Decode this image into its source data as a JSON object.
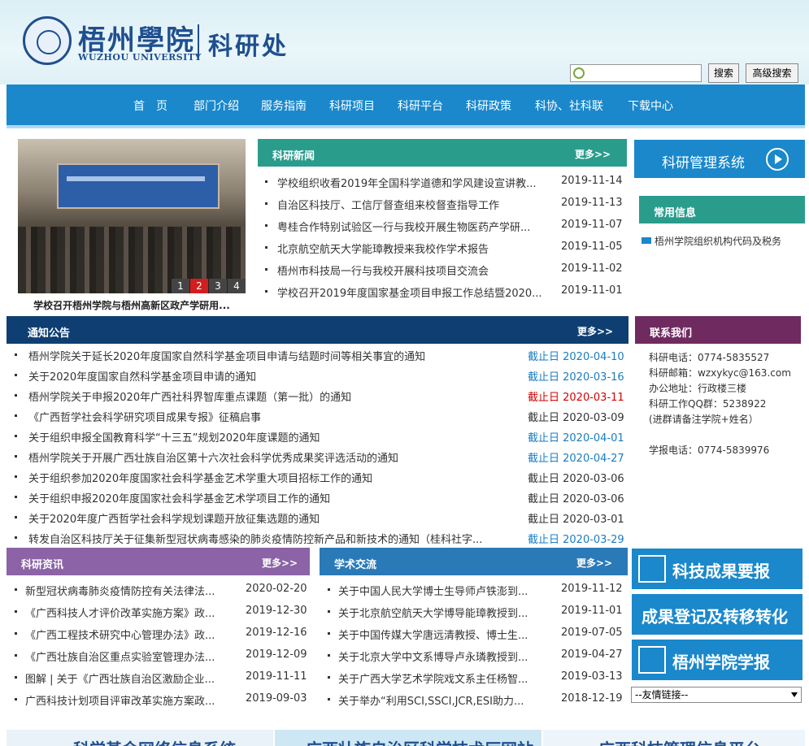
{
  "header": {
    "logo_cn": "梧州學院",
    "logo_en": "WUZHOU UNIVERSITY",
    "dept": "科研处",
    "search_placeholder": "",
    "search_label": "搜索",
    "advanced_search_label": "高级搜索"
  },
  "nav": [
    "首　页",
    "部门介绍",
    "服务指南",
    "科研项目",
    "科研平台",
    "科研政策",
    "科协、社科联",
    "下载中心"
  ],
  "slideshow": {
    "pages": [
      "1",
      "2",
      "3",
      "4"
    ],
    "active_page": 2,
    "caption": "学校召开梧州学院与梧州高新区政产学研用..."
  },
  "news": {
    "title": "科研新闻",
    "more": "更多>>",
    "items": [
      {
        "text": "学校组织收看2019年全国科学道德和学风建设宣讲教...",
        "date": "2019-11-14"
      },
      {
        "text": "自治区科技厅、工信厅督查组来校督查指导工作",
        "date": "2019-11-13"
      },
      {
        "text": "粤桂合作特别试验区一行与我校开展生物医药产学研...",
        "date": "2019-11-07"
      },
      {
        "text": "北京航空航天大学能璋教授来我校作学术报告",
        "date": "2019-11-05"
      },
      {
        "text": "梧州市科技局一行与我校开展科技项目交流会",
        "date": "2019-11-02"
      },
      {
        "text": "学校召开2019年度国家基金项目申报工作总结暨2020...",
        "date": "2019-11-01"
      }
    ]
  },
  "sidebar": {
    "system_label": "科研管理系统",
    "common_title": "常用信息",
    "common_items": [
      "梧州学院组织机构代码及税务"
    ],
    "contact_title": "联系我们",
    "contact_lines": [
      "科研电话：0774-5835527",
      "科研邮箱：wzxykyc@163.com",
      "办公地址：行政楼三楼",
      "科研工作QQ群：5238922",
      "(进群请备注学院+姓名）",
      "学报电话：0774-5839976"
    ],
    "buttons": [
      "科技成果要报",
      "成果登记及转移转化",
      "梧州学院学报"
    ],
    "friend_links": "--友情链接--"
  },
  "notice": {
    "title": "通知公告",
    "more": "更多>>",
    "items": [
      {
        "text": "梧州学院关于延长2020年度国家自然科学基金项目申请与结题时间等相关事宜的通知",
        "date": "截止日 2020-04-10",
        "status": "blue"
      },
      {
        "text": "关于2020年度国家自然科学基金项目申请的通知",
        "date": "截止日 2020-03-16",
        "status": "blue"
      },
      {
        "text": "梧州学院关于申报2020年广西社科界智库重点课题（第一批）的通知",
        "date": "截止日 2020-03-11",
        "status": "red"
      },
      {
        "text": "《广西哲学社会科学研究项目成果专报》征稿启事",
        "date": "截止日 2020-03-09",
        "status": "gray"
      },
      {
        "text": "关于组织申报全国教育科学“十三五”规划2020年度课题的通知",
        "date": "截止日 2020-04-01",
        "status": "blue"
      },
      {
        "text": "梧州学院关于开展广西壮族自治区第十六次社会科学优秀成果奖评选活动的通知",
        "date": "截止日 2020-04-27",
        "status": "blue"
      },
      {
        "text": "关于组织参加2020年度国家社会科学基金艺术学重大项目招标工作的通知",
        "date": "截止日 2020-03-06",
        "status": "gray"
      },
      {
        "text": "关于组织申报2020年度国家社会科学基金艺术学项目工作的通知",
        "date": "截止日 2020-03-06",
        "status": "gray"
      },
      {
        "text": "关于2020年度广西哲学社会科学规划课题开放征集选题的通知",
        "date": "截止日 2020-03-01",
        "status": "gray"
      },
      {
        "text": "转发自治区科技厅关于征集新型冠状病毒感染的肺炎疫情防控新产品和新技术的通知（桂科社字...",
        "date": "截止日 2020-03-29",
        "status": "blue"
      }
    ]
  },
  "info": {
    "title": "科研资讯",
    "more": "更多>>",
    "items": [
      {
        "text": "新型冠状病毒肺炎疫情防控有关法律法...",
        "date": "2020-02-20"
      },
      {
        "text": "《广西科技人才评价改革实施方案》政...",
        "date": "2019-12-30"
      },
      {
        "text": "《广西工程技术研究中心管理办法》政...",
        "date": "2019-12-16"
      },
      {
        "text": "《广西壮族自治区重点实验室管理办法...",
        "date": "2019-12-09"
      },
      {
        "text": "图解 | 关于《广西壮族自治区激励企业...",
        "date": "2019-11-11"
      },
      {
        "text": "广西科技计划项目评审改革实施方案政...",
        "date": "2019-09-03"
      }
    ]
  },
  "academic": {
    "title": "学术交流",
    "more": "更多>>",
    "items": [
      {
        "text": "关于中国人民大学博士生导师卢铁澎到...",
        "date": "2019-11-12"
      },
      {
        "text": "关于北京航空航天大学博导能璋教授到...",
        "date": "2019-11-01"
      },
      {
        "text": "关于中国传媒大学唐远清教授、博士生...",
        "date": "2019-07-05"
      },
      {
        "text": "关于北京大学中文系博导卢永璘教授到...",
        "date": "2019-04-27"
      },
      {
        "text": "关于广西大学艺术学院戏文系主任杨智...",
        "date": "2019-03-13"
      },
      {
        "text": "关于举办“利用SCI,SSCI,JCR,ESI助力...",
        "date": "2018-12-19"
      }
    ]
  },
  "banners": [
    "科学基金网络信息系统",
    "广西壮族自治区科学技术厅网站",
    "广西科技管理信息平台"
  ],
  "colors": {
    "nav_blue": "#1a88cb",
    "news_green": "#2a9c8c",
    "notice_navy": "#0f3f72",
    "contact_purple": "#6f2a60",
    "info_purple": "#8b63a6",
    "academic_blue": "#2a7ab8",
    "deadline_blue": "#1a7cc0",
    "deadline_red": "#d40000"
  }
}
